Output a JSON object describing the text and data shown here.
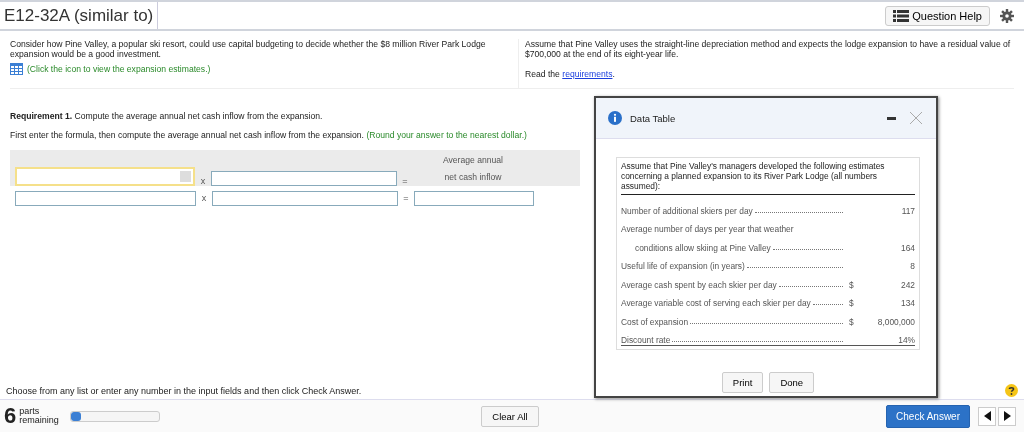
{
  "header": {
    "title": "E12-32A (similar to)",
    "help_button": "Question Help"
  },
  "intro": {
    "left": "Consider how Pine Valley, a popular ski resort, could use capital budgeting to decide whether the $8 million River Park Lodge expansion would be a good investment.",
    "icon_link": "(Click the icon to view the expansion estimates.)",
    "right": "Assume that Pine Valley uses the straight-line depreciation method and expects the lodge expansion to have a residual value of $700,000 at the end of its eight-year life.",
    "read_prefix": "Read the",
    "read_link": "requirements",
    "read_suffix": "."
  },
  "requirement": {
    "text": "**Requirement 1.** Compute the average annual net cash inflow from the expansion.",
    "instruction": "First enter the formula, then compute the average annual net cash inflow from the expansion.",
    "hint": "(Round your answer to the nearest dollar.)"
  },
  "formula": {
    "rows": [
      {
        "times": "x",
        "equals": "="
      },
      {
        "times": "x",
        "equals": "="
      }
    ],
    "result_header": [
      "Average annual",
      "net cash inflow"
    ]
  },
  "dialog": {
    "title": "Data Table",
    "intro": "Assume that Pine Valley's managers developed the following estimates concerning a planned expansion to its River Park Lodge (all numbers assumed):",
    "rows": [
      {
        "kind": "item",
        "label": "Number of additional skiers per day",
        "currency": "",
        "value": "117"
      },
      {
        "kind": "heading",
        "label": "Average number of days per year that weather",
        "currency": "",
        "value": ""
      },
      {
        "kind": "continuation",
        "label": "conditions allow skiing at Pine Valley",
        "currency": "",
        "value": "164"
      },
      {
        "kind": "item",
        "label": "Useful life of expansion (in years)",
        "currency": "",
        "value": "8"
      },
      {
        "kind": "item",
        "label": "Average cash spent by each skier per day",
        "currency": "$",
        "value": "242"
      },
      {
        "kind": "item",
        "label": "Average variable cost of serving each skier per day",
        "currency": "$",
        "value": "134"
      },
      {
        "kind": "item",
        "label": "Cost of expansion",
        "currency": "$",
        "value": "8,000,000"
      },
      {
        "kind": "item",
        "label": "Discount rate",
        "currency": "",
        "value": "14%"
      }
    ],
    "buttons": [
      "Print",
      "Done"
    ]
  },
  "footer": {
    "instruction": "Choose from any list or enter any number in the input fields and then click Check Answer.",
    "parts_count": "6",
    "parts_label": [
      "parts",
      "remaining"
    ],
    "progress": {
      "level": 0.12
    },
    "clear_button": "Clear All",
    "check_button": "Check Answer"
  }
}
